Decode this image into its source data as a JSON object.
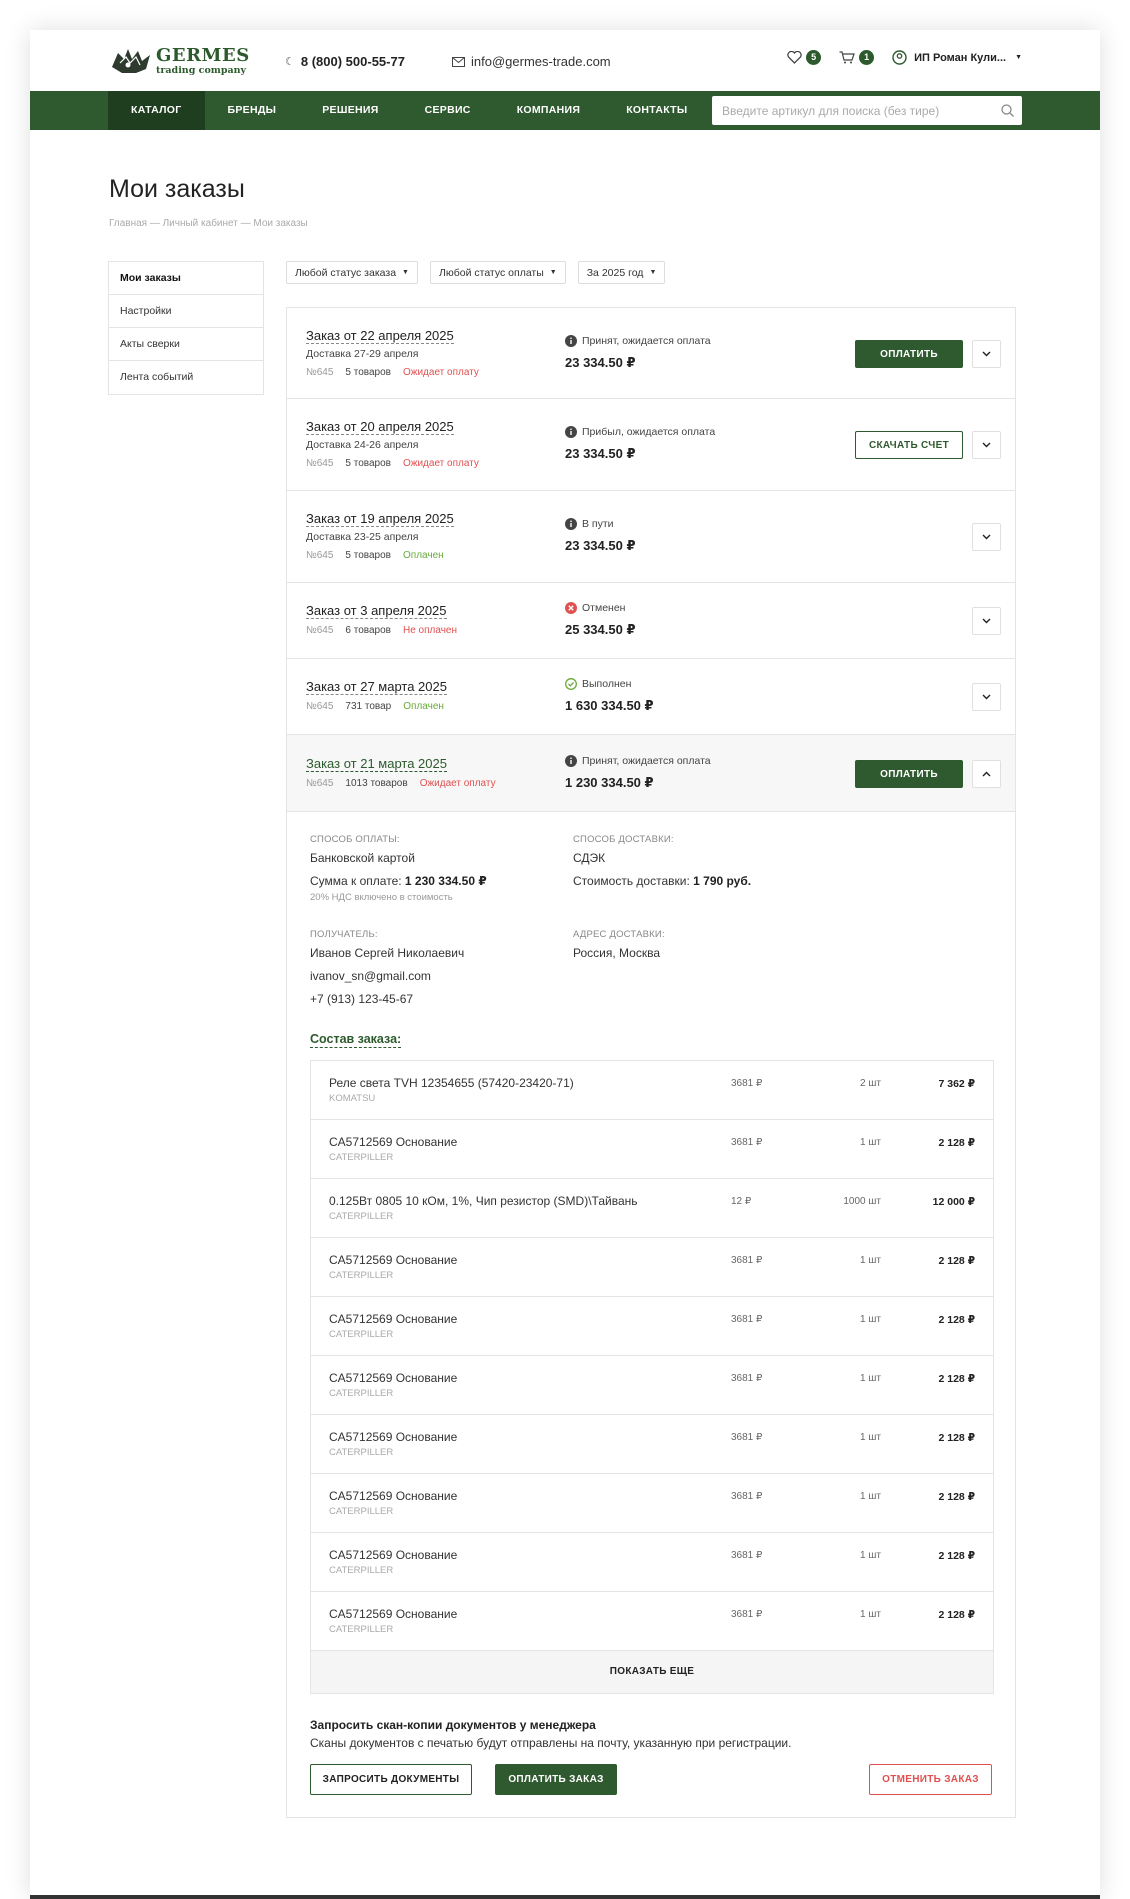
{
  "header": {
    "logo_main": "GERMES",
    "logo_sub": "trading company",
    "phone": "8 (800) 500-55-77",
    "email": "info@germes-trade.com",
    "favorites_count": "5",
    "cart_count": "1",
    "user_name": "ИП Роман Кули..."
  },
  "nav": {
    "items": [
      "КАТАЛОГ",
      "БРЕНДЫ",
      "РЕШЕНИЯ",
      "СЕРВИС",
      "КОМПАНИЯ",
      "КОНТАКТЫ"
    ],
    "search_placeholder": "Введите артикул для поиска (без тире)"
  },
  "page": {
    "title": "Мои заказы",
    "breadcrumb": "Главная — Личный кабинет — Мои заказы"
  },
  "sidebar": {
    "items": [
      "Мои заказы",
      "Настройки",
      "Акты сверки",
      "Лента событий"
    ]
  },
  "filters": {
    "order_status": "Любой статус заказа",
    "payment_status": "Любой статус оплаты",
    "year": "За 2025 год"
  },
  "orders": [
    {
      "title": "Заказ от 22 апреля 2025",
      "delivery": "Доставка 27-29 апреля",
      "number": "№645",
      "count": "5 товаров",
      "pay_status": "Ожидает оплату",
      "status": "Принят, ожидается оплата",
      "sum": "23 334.50 ₽",
      "action": "ОПЛАТИТЬ"
    },
    {
      "title": "Заказ от 20 апреля 2025",
      "delivery": "Доставка 24-26 апреля",
      "number": "№645",
      "count": "5 товаров",
      "pay_status": "Ожидает оплату",
      "status": "Прибыл, ожидается оплата",
      "sum": "23 334.50 ₽",
      "action": "СКАЧАТЬ СЧЕТ"
    },
    {
      "title": "Заказ от 19 апреля 2025",
      "delivery": "Доставка 23-25 апреля",
      "number": "№645",
      "count": "5 товаров",
      "pay_status": "Оплачен",
      "status": "В пути",
      "sum": "23 334.50 ₽"
    },
    {
      "title": "Заказ от 3 апреля 2025",
      "number": "№645",
      "count": "6 товаров",
      "pay_status": "Не оплачен",
      "status": "Отменен",
      "sum": "25 334.50 ₽"
    },
    {
      "title": "Заказ от 27 марта 2025",
      "number": "№645",
      "count": "731 товар",
      "pay_status": "Оплачен",
      "status": "Выполнен",
      "sum": "1 630 334.50 ₽"
    },
    {
      "title": "Заказ от 21 марта 2025",
      "number": "№645",
      "count": "1013 товаров",
      "pay_status": "Ожидает оплату",
      "status": "Принят, ожидается оплата",
      "sum": "1 230 334.50 ₽",
      "action": "ОПЛАТИТЬ"
    }
  ],
  "details": {
    "payment_label": "СПОСОБ ОПЛАТЫ:",
    "payment_value": "Банковской картой",
    "amount_label": "Сумма к оплате:",
    "amount_value": "1 230 334.50 ₽",
    "vat_note": "20% НДС включено в стоимость",
    "delivery_label": "СПОСОБ ДОСТАВКИ:",
    "delivery_value": "СДЭК",
    "delivery_cost_label": "Стоимость доставки:",
    "delivery_cost_value": "1 790 руб.",
    "recipient_label": "ПОЛУЧАТЕЛЬ:",
    "recipient_name": "Иванов Сергей Николаевич",
    "recipient_email": "ivanov_sn@gmail.com",
    "recipient_phone": "+7 (913) 123-45-67",
    "address_label": "АДРЕС ДОСТАВКИ:",
    "address_value": "Россия, Москва",
    "composition_title": "Состав заказа:",
    "items": [
      {
        "name": "Реле света TVH 12354655 (57420-23420-71)",
        "brand": "KOMATSU",
        "price": "3681 ₽",
        "qty": "2 шт",
        "total": "7 362 ₽"
      },
      {
        "name": "CA5712569 Основание",
        "brand": "CATERPILLER",
        "price": "3681 ₽",
        "qty": "1 шт",
        "total": "2 128 ₽"
      },
      {
        "name": "0.125Вт 0805 10 кОм, 1%, Чип резистор (SMD)\\Тайвань",
        "brand": "CATERPILLER",
        "price": "12 ₽",
        "qty": "1000 шт",
        "total": "12 000 ₽"
      },
      {
        "name": "CA5712569 Основание",
        "brand": "CATERPILLER",
        "price": "3681 ₽",
        "qty": "1 шт",
        "total": "2 128 ₽"
      },
      {
        "name": "CA5712569 Основание",
        "brand": "CATERPILLER",
        "price": "3681 ₽",
        "qty": "1 шт",
        "total": "2 128 ₽"
      },
      {
        "name": "CA5712569 Основание",
        "brand": "CATERPILLER",
        "price": "3681 ₽",
        "qty": "1 шт",
        "total": "2 128 ₽"
      },
      {
        "name": "CA5712569 Основание",
        "brand": "CATERPILLER",
        "price": "3681 ₽",
        "qty": "1 шт",
        "total": "2 128 ₽"
      },
      {
        "name": "CA5712569 Основание",
        "brand": "CATERPILLER",
        "price": "3681 ₽",
        "qty": "1 шт",
        "total": "2 128 ₽"
      },
      {
        "name": "CA5712569 Основание",
        "brand": "CATERPILLER",
        "price": "3681 ₽",
        "qty": "1 шт",
        "total": "2 128 ₽"
      },
      {
        "name": "CA5712569 Основание",
        "brand": "CATERPILLER",
        "price": "3681 ₽",
        "qty": "1 шт",
        "total": "2 128 ₽"
      }
    ],
    "show_more": "ПОКАЗАТЬ ЕЩЕ",
    "request_title": "Запросить скан-копии документов у менеджера",
    "request_text": "Сканы документов с печатью будут отправлены на почту, указанную при регистрации.",
    "btn_request": "ЗАПРОСИТЬ ДОКУМЕНТЫ",
    "btn_pay": "ОПЛАТИТЬ ЗАКАЗ",
    "btn_cancel": "ОТМЕНИТЬ ЗАКАЗ"
  },
  "colors": {
    "brand": "#2f5a2f",
    "danger": "#e05050",
    "success": "#6aaa3a"
  }
}
